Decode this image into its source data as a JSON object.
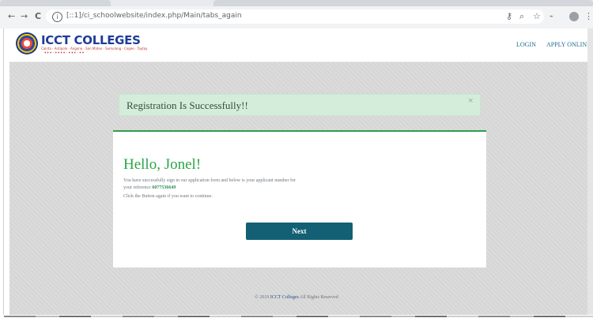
{
  "browser": {
    "url": "[::1]/ci_schoolwebsite/index.php/Main/tabs_again",
    "back_glyph": "←",
    "forward_glyph": "→",
    "reload_glyph": "C",
    "info_glyph": "i"
  },
  "site": {
    "logo_text": "ICCT COLLEGES",
    "logo_tagline": "Cainta · Antipolo · Angono · San Mateo · Sumulong · Cogeo · Taytay",
    "logo_phone": "♦♦♦·♦♦♦♦·♦♦♦·♦♦",
    "nav": {
      "login": "LOGIN",
      "apply": "APPLY ONLINE"
    }
  },
  "alert": {
    "message": "Registration Is Successfully!!",
    "close": "×"
  },
  "card": {
    "greeting": "Hello, Jonel!",
    "line1": "You have successfully sign in our application form and below is your applicant number for",
    "line2_prefix": "your reference ",
    "reference_number": "6077536649",
    "line3": "Click the Button again if you want to continue.",
    "button_label": "Next"
  },
  "footer": {
    "prefix": "© 2019 ",
    "brand": "ICCT Colleges",
    "suffix": " All Rights Reserved"
  },
  "colors": {
    "alert_bg": "#d4edda",
    "greeting": "#28a745",
    "button": "#135f74",
    "page_bg": "#d9d9d9"
  }
}
